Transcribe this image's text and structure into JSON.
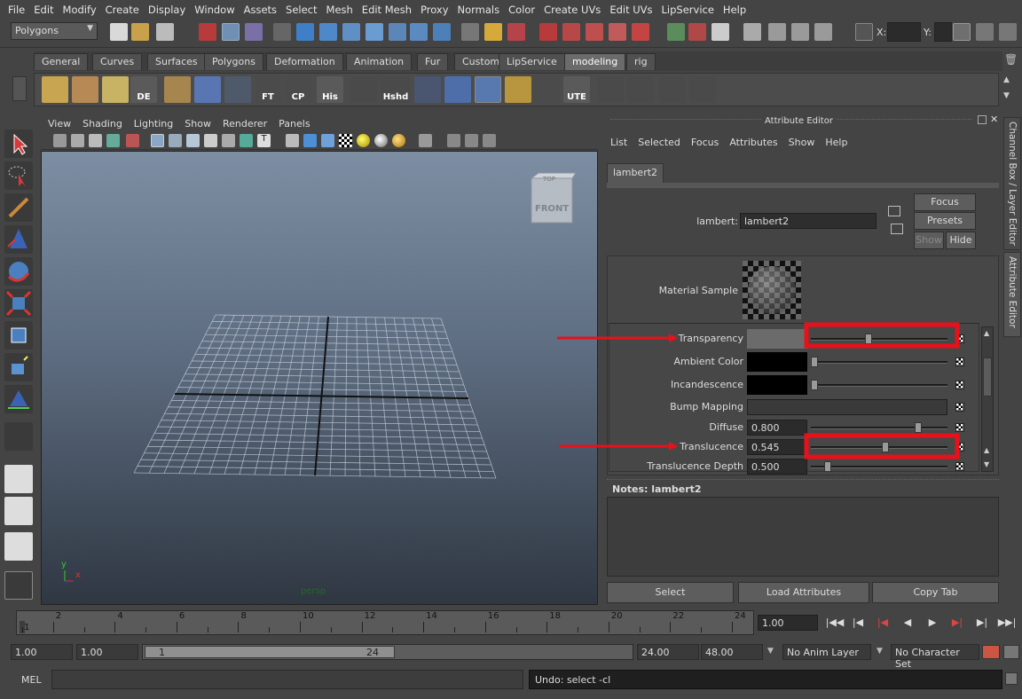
{
  "menubar": {
    "items": [
      "File",
      "Edit",
      "Modify",
      "Create",
      "Display",
      "Window",
      "Assets",
      "Select",
      "Mesh",
      "Edit Mesh",
      "Proxy",
      "Normals",
      "Color",
      "Create UVs",
      "Edit UVs",
      "LipService",
      "Help"
    ]
  },
  "statusline": {
    "menuset": "Polygons",
    "x_label": "X:",
    "y_label": "Y:"
  },
  "shelf": {
    "tabs": [
      "General",
      "Curves",
      "Surfaces",
      "Polygons",
      "Deformation",
      "Animation",
      "Fur",
      "Custom",
      "LipService",
      "modeling",
      "rig"
    ],
    "active_tab": "modeling",
    "icon_labels": [
      "DE",
      "FT",
      "CP",
      "His",
      "Hshd",
      "UTE"
    ]
  },
  "viewport": {
    "menus": [
      "View",
      "Shading",
      "Lighting",
      "Show",
      "Renderer",
      "Panels"
    ],
    "camera_label": "persp",
    "viewcube_top": "TOP",
    "viewcube_front": "FRONT",
    "axis_y": "y",
    "axis_x": "x"
  },
  "attribute_editor": {
    "title": "Attribute Editor",
    "menus": [
      "List",
      "Selected",
      "Focus",
      "Attributes",
      "Show",
      "Help"
    ],
    "tab": "lambert2",
    "node_label": "lambert:",
    "node_name": "lambert2",
    "focus_button": "Focus",
    "presets_button": "Presets",
    "show_button": "Show",
    "hide_button": "Hide",
    "material_sample_label": "Material Sample",
    "attributes": [
      {
        "label": "Transparency",
        "value": "",
        "slider": 0.42
      },
      {
        "label": "Ambient Color",
        "value": "",
        "slider": 0.0
      },
      {
        "label": "Incandescence",
        "value": "",
        "slider": 0.0
      },
      {
        "label": "Bump Mapping",
        "value": ""
      },
      {
        "label": "Diffuse",
        "value": "0.800",
        "slider": 0.8
      },
      {
        "label": "Translucence",
        "value": "0.545",
        "slider": 0.545
      },
      {
        "label": "Translucence Depth",
        "value": "0.500",
        "slider": 0.1
      }
    ],
    "notes_label": "Notes:  lambert2",
    "select_button": "Select",
    "load_attributes_button": "Load Attributes",
    "copy_tab_button": "Copy Tab"
  },
  "side_tabs": {
    "channel_box": "Channel Box / Layer Editor",
    "attribute_editor": "Attribute Editor"
  },
  "timeline": {
    "ticks": [
      "1",
      "2",
      "4",
      "6",
      "8",
      "10",
      "12",
      "14",
      "16",
      "18",
      "20",
      "22",
      "24"
    ],
    "current_frame": "1.00"
  },
  "range": {
    "start_time": "1.00",
    "playback_start": "1.00",
    "slider_start": "1",
    "slider_end": "24",
    "playback_end": "24.00",
    "end_time": "48.00",
    "anim_layer": "No Anim Layer",
    "character_set": "No Character Set"
  },
  "command_line": {
    "mode": "MEL",
    "result": "Undo: select -cl"
  },
  "colors": {
    "annotation_red": "#e8101a",
    "panel_bg": "#444444",
    "field_bg": "#2b2b2b"
  }
}
